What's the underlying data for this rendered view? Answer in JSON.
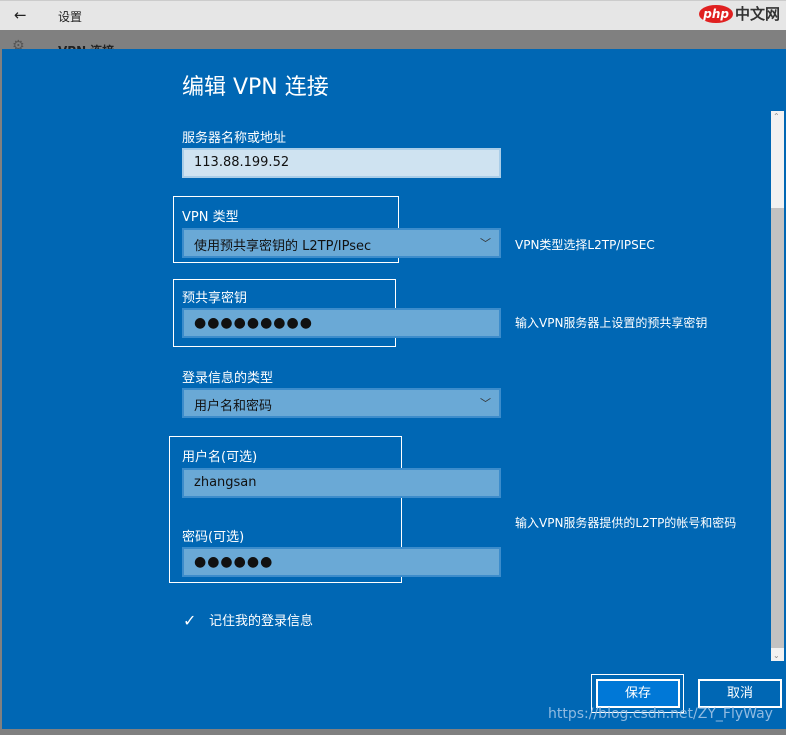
{
  "window": {
    "back_icon": "←",
    "title": "设置",
    "logo_php": "php",
    "logo_cn": "中文网",
    "behind_title": "VPN 连接"
  },
  "dialog": {
    "title": "编辑 VPN 连接",
    "server_label": "服务器名称或地址",
    "server_value": "113.88.199.52",
    "vpn_type_label": "VPN 类型",
    "vpn_type_value": "使用预共享密钥的 L2TP/IPsec",
    "psk_label": "预共享密钥",
    "psk_value": "●●●●●●●●●",
    "signin_type_label": "登录信息的类型",
    "signin_type_value": "用户名和密码",
    "username_label": "用户名(可选)",
    "username_value": "zhangsan",
    "password_label": "密码(可选)",
    "password_value": "●●●●●●",
    "remember_label": "记住我的登录信息",
    "remember_checked": true,
    "save_label": "保存",
    "cancel_label": "取消"
  },
  "notes": {
    "vpn_type": "VPN类型选择L2TP/IPSEC",
    "psk": "输入VPN服务器上设置的预共享密钥",
    "account": "输入VPN服务器提供的L2TP的帐号和密码"
  },
  "watermark": "https://blog.csdn.net/ZY_FlyWay"
}
